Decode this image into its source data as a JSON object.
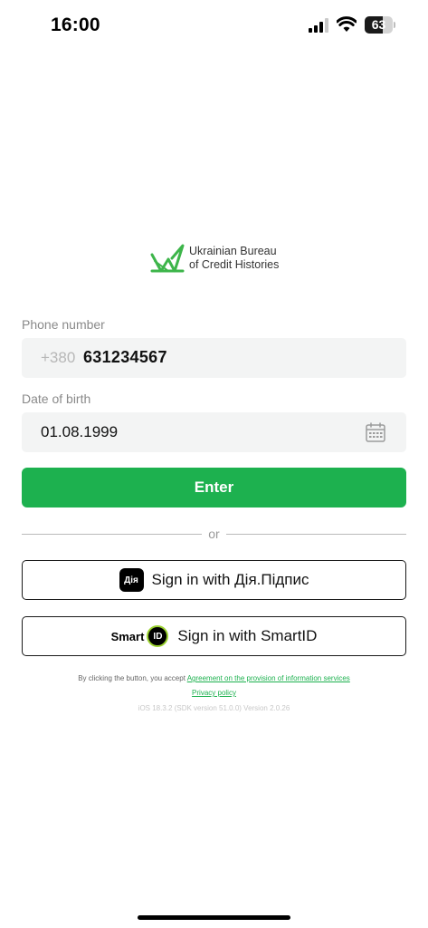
{
  "status_bar": {
    "time": "16:00",
    "battery_level": "63",
    "battery_fraction": 0.63
  },
  "logo": {
    "line1": "Ukrainian Bureau",
    "line2": "of Credit Histories",
    "accent": "#3db54a"
  },
  "form": {
    "phone_label": "Phone number",
    "phone_prefix": "+380",
    "phone_value": "631234567",
    "dob_label": "Date of birth",
    "dob_value": "01.08.1999",
    "enter_label": "Enter",
    "or_label": "or",
    "diia_icon_text": "Дія",
    "diia_label": "Sign in with Дія.Підпис",
    "smartid_brand": "Smart",
    "smartid_badge": "ID",
    "smartid_label": "Sign in with SmartID"
  },
  "icons": [
    "signal-icon",
    "wifi-icon",
    "battery-icon",
    "logo-mark-icon",
    "calendar-icon",
    "diia-icon",
    "smartid-icon"
  ],
  "legal": {
    "prefix": "By clicking the button, you accept ",
    "agreement_link": "Agreement on the provision of information services",
    "privacy_link": "Privacy policy",
    "version": "iOS 18.3.2 (SDK version 51.0.0) Version 2.0.26"
  },
  "colors": {
    "primary_green": "#1db14f",
    "input_bg": "#f3f4f4",
    "label_gray": "#8a8a8a"
  }
}
